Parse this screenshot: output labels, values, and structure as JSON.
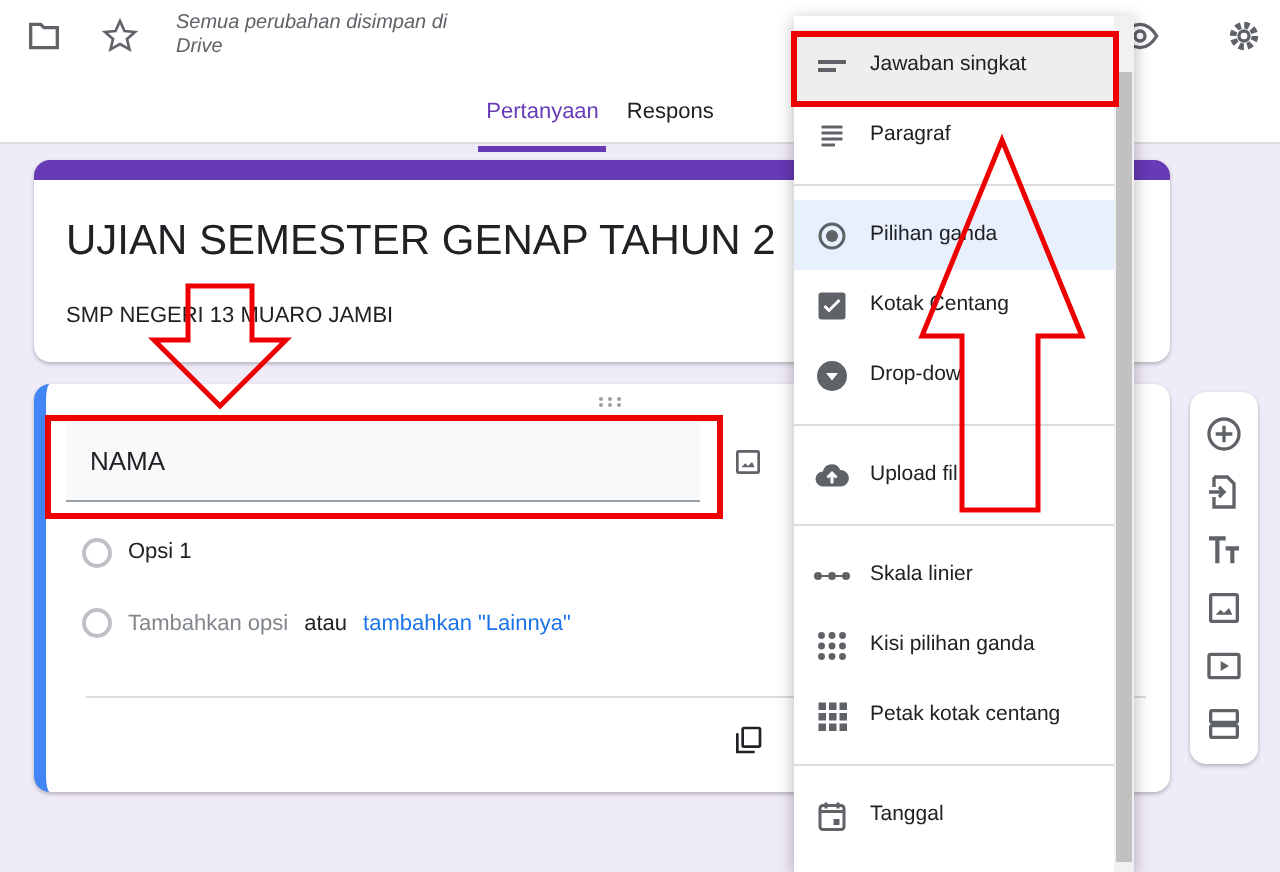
{
  "header": {
    "saved_status": "Semua perubahan disimpan di Drive",
    "tabs": [
      {
        "label": "Pertanyaan",
        "selected": true
      },
      {
        "label": "Respons",
        "selected": false
      }
    ]
  },
  "form": {
    "title": "UJIAN SEMESTER GENAP TAHUN 2",
    "description": "SMP NEGERI 13 MUARO JAMBI"
  },
  "question": {
    "title": "NAMA",
    "options": [
      {
        "label": "Opsi 1",
        "checked": false
      }
    ],
    "add_option": "Tambahkan opsi",
    "add_option_checked": false,
    "separator": "atau",
    "add_other": "tambahkan \"Lainnya\""
  },
  "type_menu": {
    "items": [
      {
        "kind": "short-answer",
        "label": "Jawaban singkat",
        "hovered": true,
        "selected": false,
        "divider_above": false
      },
      {
        "kind": "paragraph",
        "label": "Paragraf",
        "hovered": false,
        "selected": false,
        "divider_above": false
      },
      {
        "kind": "radio",
        "label": "Pilihan ganda",
        "hovered": false,
        "selected": true,
        "divider_above": true
      },
      {
        "kind": "checkbox",
        "label": "Kotak Centang",
        "hovered": false,
        "selected": false,
        "divider_above": false
      },
      {
        "kind": "dropdown",
        "label": "Drop-dow",
        "hovered": false,
        "selected": false,
        "divider_above": false
      },
      {
        "kind": "upload",
        "label": "Upload fil",
        "hovered": false,
        "selected": false,
        "divider_above": true
      },
      {
        "kind": "scale",
        "label": "Skala linier",
        "hovered": false,
        "selected": false,
        "divider_above": true
      },
      {
        "kind": "grid-radio",
        "label": "Kisi pilihan ganda",
        "hovered": false,
        "selected": false,
        "divider_above": false
      },
      {
        "kind": "grid-check",
        "label": "Petak kotak centang",
        "hovered": false,
        "selected": false,
        "divider_above": false
      },
      {
        "kind": "date",
        "label": "Tanggal",
        "hovered": false,
        "selected": false,
        "divider_above": true
      }
    ]
  }
}
